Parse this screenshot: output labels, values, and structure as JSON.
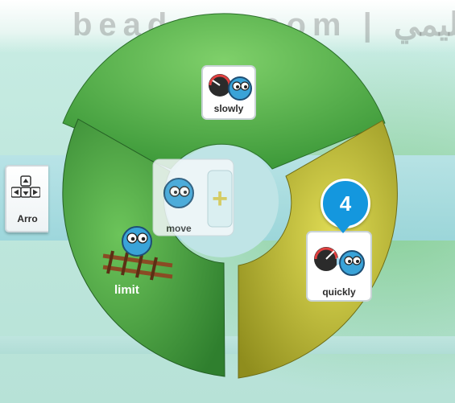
{
  "watermark": "beadaya.com | عليمي",
  "wheel": {
    "segments": [
      {
        "name": "slowly",
        "label": "slowly",
        "icon": "speedometer-slow-icon",
        "color": "#5dbb4f"
      },
      {
        "name": "limit",
        "label": "limit",
        "icon": "track-limit-icon",
        "color": "#4fa843"
      },
      {
        "name": "quickly",
        "label": "quickly",
        "icon": "speedometer-fast-icon",
        "color": "#c7c436"
      }
    ],
    "center": {
      "label": "move",
      "icon": "character-icon",
      "plus": "+"
    }
  },
  "side_block": {
    "label": "Arro",
    "icon": "arrow-keys-icon"
  },
  "badge": {
    "number": "4",
    "color": "#1497de"
  }
}
